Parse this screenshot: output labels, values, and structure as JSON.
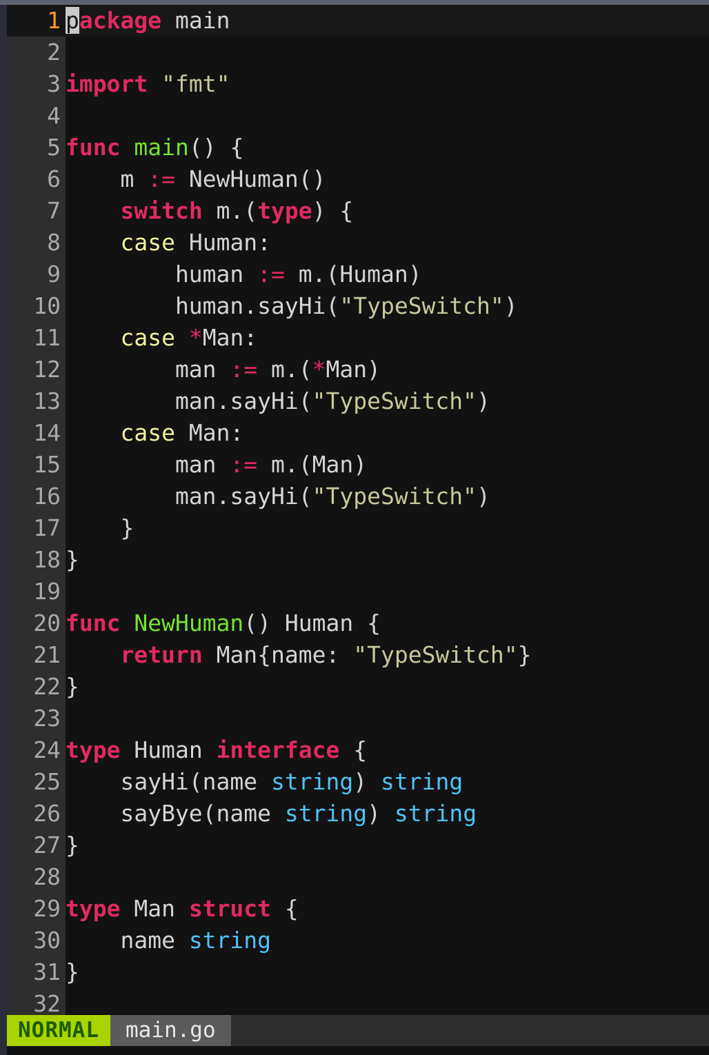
{
  "app": {
    "kind": "vim-editor",
    "colors": {
      "background": "#121212",
      "gutter": "#2e2e2e",
      "keyword": "#e02a60",
      "function": "#76e22e",
      "string": "#c8c89b",
      "type": "#4fc3f7",
      "case_label": "#f2f2a0",
      "line_number": "#a9a9a9",
      "cursor_line_number": "#ff9b21",
      "cursor_block": "#c9c9c9",
      "mode_badge_bg": "#aad400",
      "mode_badge_fg": "#1c5c00",
      "file_badge_bg": "#5b5b5b",
      "statusline_bg": "#2d2d2d",
      "chrome_border": "#2b2e3a"
    }
  },
  "statusline": {
    "mode": "NORMAL",
    "filename": "main.go"
  },
  "editor": {
    "cursor": {
      "line": 1,
      "column": 1,
      "char": "p"
    },
    "lines": [
      {
        "n": "1",
        "cursorline": true,
        "tokens": [
          {
            "t": "p",
            "c": "cursor"
          },
          {
            "t": "ackage",
            "c": "kw"
          },
          {
            "t": " main",
            "c": "plain"
          }
        ]
      },
      {
        "n": "2",
        "cursorline": false,
        "tokens": []
      },
      {
        "n": "3",
        "cursorline": false,
        "tokens": [
          {
            "t": "import",
            "c": "kw"
          },
          {
            "t": " ",
            "c": "plain"
          },
          {
            "t": "\"fmt\"",
            "c": "str"
          }
        ]
      },
      {
        "n": "4",
        "cursorline": false,
        "tokens": []
      },
      {
        "n": "5",
        "cursorline": false,
        "tokens": [
          {
            "t": "func",
            "c": "kw"
          },
          {
            "t": " ",
            "c": "plain"
          },
          {
            "t": "main",
            "c": "fn"
          },
          {
            "t": "() {",
            "c": "plain"
          }
        ]
      },
      {
        "n": "6",
        "cursorline": false,
        "tokens": [
          {
            "t": "    m ",
            "c": "plain"
          },
          {
            "t": ":=",
            "c": "op"
          },
          {
            "t": " NewHuman()",
            "c": "plain"
          }
        ]
      },
      {
        "n": "7",
        "cursorline": false,
        "tokens": [
          {
            "t": "    ",
            "c": "plain"
          },
          {
            "t": "switch",
            "c": "kw"
          },
          {
            "t": " m.(",
            "c": "plain"
          },
          {
            "t": "type",
            "c": "kw"
          },
          {
            "t": ") {",
            "c": "plain"
          }
        ]
      },
      {
        "n": "8",
        "cursorline": false,
        "tokens": [
          {
            "t": "    ",
            "c": "plain"
          },
          {
            "t": "case",
            "c": "case"
          },
          {
            "t": " Human:",
            "c": "plain"
          }
        ]
      },
      {
        "n": "9",
        "cursorline": false,
        "tokens": [
          {
            "t": "        human ",
            "c": "plain"
          },
          {
            "t": ":=",
            "c": "op"
          },
          {
            "t": " m.(Human)",
            "c": "plain"
          }
        ]
      },
      {
        "n": "10",
        "cursorline": false,
        "tokens": [
          {
            "t": "        human.sayHi(",
            "c": "plain"
          },
          {
            "t": "\"TypeSwitch\"",
            "c": "str"
          },
          {
            "t": ")",
            "c": "plain"
          }
        ]
      },
      {
        "n": "11",
        "cursorline": false,
        "tokens": [
          {
            "t": "    ",
            "c": "plain"
          },
          {
            "t": "case",
            "c": "case"
          },
          {
            "t": " ",
            "c": "plain"
          },
          {
            "t": "*",
            "c": "star"
          },
          {
            "t": "Man:",
            "c": "plain"
          }
        ]
      },
      {
        "n": "12",
        "cursorline": false,
        "tokens": [
          {
            "t": "        man ",
            "c": "plain"
          },
          {
            "t": ":=",
            "c": "op"
          },
          {
            "t": " m.(",
            "c": "plain"
          },
          {
            "t": "*",
            "c": "star"
          },
          {
            "t": "Man)",
            "c": "plain"
          }
        ]
      },
      {
        "n": "13",
        "cursorline": false,
        "tokens": [
          {
            "t": "        man.sayHi(",
            "c": "plain"
          },
          {
            "t": "\"TypeSwitch\"",
            "c": "str"
          },
          {
            "t": ")",
            "c": "plain"
          }
        ]
      },
      {
        "n": "14",
        "cursorline": false,
        "tokens": [
          {
            "t": "    ",
            "c": "plain"
          },
          {
            "t": "case",
            "c": "case"
          },
          {
            "t": " Man:",
            "c": "plain"
          }
        ]
      },
      {
        "n": "15",
        "cursorline": false,
        "tokens": [
          {
            "t": "        man ",
            "c": "plain"
          },
          {
            "t": ":=",
            "c": "op"
          },
          {
            "t": " m.(Man)",
            "c": "plain"
          }
        ]
      },
      {
        "n": "16",
        "cursorline": false,
        "tokens": [
          {
            "t": "        man.sayHi(",
            "c": "plain"
          },
          {
            "t": "\"TypeSwitch\"",
            "c": "str"
          },
          {
            "t": ")",
            "c": "plain"
          }
        ]
      },
      {
        "n": "17",
        "cursorline": false,
        "tokens": [
          {
            "t": "    }",
            "c": "plain"
          }
        ]
      },
      {
        "n": "18",
        "cursorline": false,
        "tokens": [
          {
            "t": "}",
            "c": "plain"
          }
        ]
      },
      {
        "n": "19",
        "cursorline": false,
        "tokens": []
      },
      {
        "n": "20",
        "cursorline": false,
        "tokens": [
          {
            "t": "func",
            "c": "kw"
          },
          {
            "t": " ",
            "c": "plain"
          },
          {
            "t": "NewHuman",
            "c": "fn"
          },
          {
            "t": "() Human {",
            "c": "plain"
          }
        ]
      },
      {
        "n": "21",
        "cursorline": false,
        "tokens": [
          {
            "t": "    ",
            "c": "plain"
          },
          {
            "t": "return",
            "c": "kw"
          },
          {
            "t": " Man{name: ",
            "c": "plain"
          },
          {
            "t": "\"TypeSwitch\"",
            "c": "str"
          },
          {
            "t": "}",
            "c": "plain"
          }
        ]
      },
      {
        "n": "22",
        "cursorline": false,
        "tokens": [
          {
            "t": "}",
            "c": "plain"
          }
        ]
      },
      {
        "n": "23",
        "cursorline": false,
        "tokens": []
      },
      {
        "n": "24",
        "cursorline": false,
        "tokens": [
          {
            "t": "type",
            "c": "kw"
          },
          {
            "t": " Human ",
            "c": "plain"
          },
          {
            "t": "interface",
            "c": "kw"
          },
          {
            "t": " {",
            "c": "plain"
          }
        ]
      },
      {
        "n": "25",
        "cursorline": false,
        "tokens": [
          {
            "t": "    sayHi(name ",
            "c": "plain"
          },
          {
            "t": "string",
            "c": "type"
          },
          {
            "t": ") ",
            "c": "plain"
          },
          {
            "t": "string",
            "c": "type"
          }
        ]
      },
      {
        "n": "26",
        "cursorline": false,
        "tokens": [
          {
            "t": "    sayBye(name ",
            "c": "plain"
          },
          {
            "t": "string",
            "c": "type"
          },
          {
            "t": ") ",
            "c": "plain"
          },
          {
            "t": "string",
            "c": "type"
          }
        ]
      },
      {
        "n": "27",
        "cursorline": false,
        "tokens": [
          {
            "t": "}",
            "c": "plain"
          }
        ]
      },
      {
        "n": "28",
        "cursorline": false,
        "tokens": []
      },
      {
        "n": "29",
        "cursorline": false,
        "tokens": [
          {
            "t": "type",
            "c": "kw"
          },
          {
            "t": " Man ",
            "c": "plain"
          },
          {
            "t": "struct",
            "c": "kw"
          },
          {
            "t": " {",
            "c": "plain"
          }
        ]
      },
      {
        "n": "30",
        "cursorline": false,
        "tokens": [
          {
            "t": "    name ",
            "c": "plain"
          },
          {
            "t": "string",
            "c": "type"
          }
        ]
      },
      {
        "n": "31",
        "cursorline": false,
        "tokens": [
          {
            "t": "}",
            "c": "plain"
          }
        ]
      },
      {
        "n": "32",
        "cursorline": false,
        "tokens": []
      }
    ]
  }
}
